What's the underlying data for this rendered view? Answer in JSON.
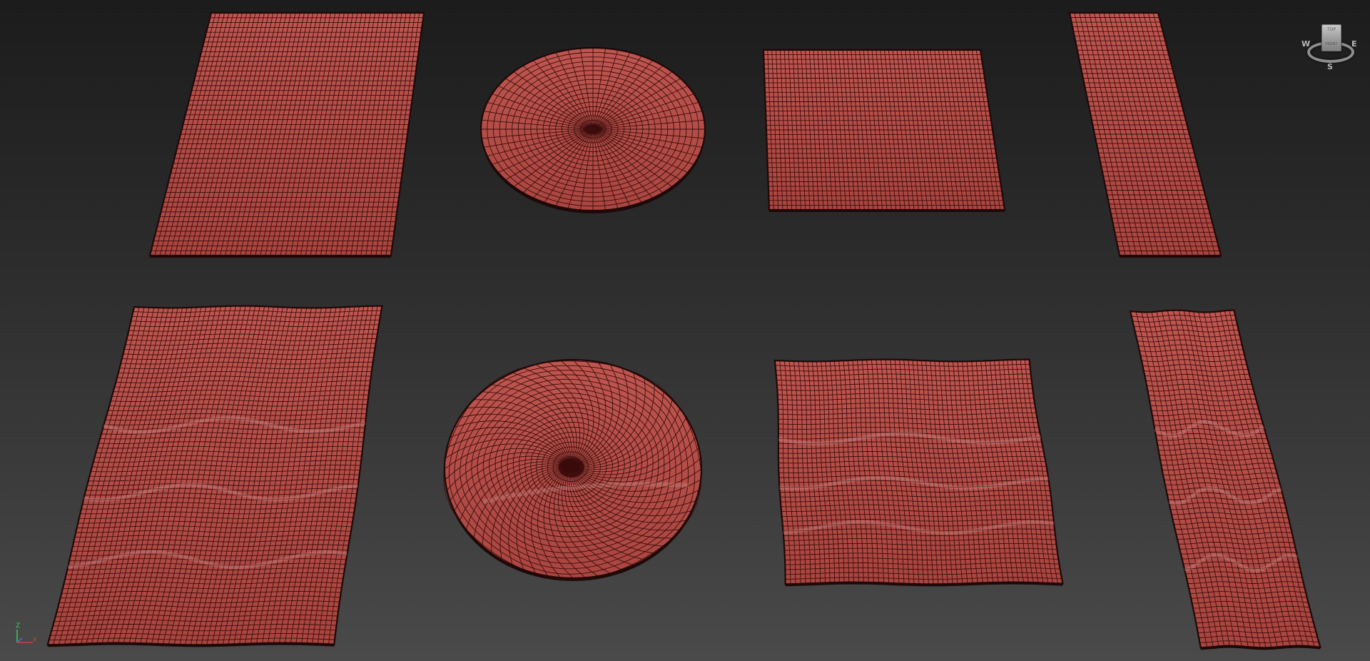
{
  "viewport": {
    "background_top": "#1c1c1c",
    "background_bottom": "#4a4a4a"
  },
  "mesh_style": {
    "fill": "#b54d47",
    "wire": "#3a0d0c",
    "edge": "#1e0808",
    "highlight": "#d8a0a0"
  },
  "viewcube": {
    "face_label": "TOP",
    "front_label": "FRONT",
    "west": "W",
    "east": "E",
    "south": "S"
  },
  "axis": {
    "z_label": "Z",
    "x_label": "X"
  }
}
